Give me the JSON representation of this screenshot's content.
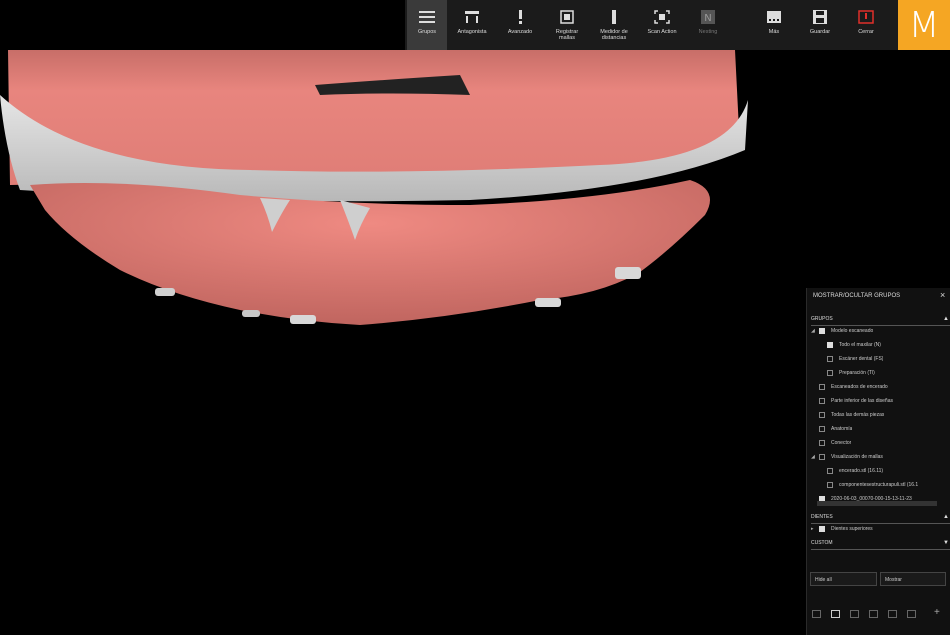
{
  "toolbar": {
    "items": [
      {
        "label": "Grupos",
        "icon": "menu-icon",
        "active": true
      },
      {
        "label": "Antagonista",
        "icon": "antagonist-icon"
      },
      {
        "label": "Avanzado",
        "icon": "exclamation-icon"
      },
      {
        "label": "Registrar\nmallas",
        "icon": "register-mesh-icon"
      },
      {
        "label": "Medidor de\ndistancias",
        "icon": "distance-meter-icon"
      },
      {
        "label": "Scan Action",
        "icon": "scan-icon"
      },
      {
        "label": "Nesting",
        "icon": "nesting-icon",
        "disabled": true
      },
      {
        "label": "Más",
        "icon": "more-icon"
      },
      {
        "label": "Guardar",
        "icon": "save-icon"
      },
      {
        "label": "Cerrar",
        "icon": "power-icon",
        "color": "#e0302a"
      }
    ],
    "logo": "M",
    "logo_color": "#f5a623"
  },
  "panel": {
    "title": "MOSTRAR/OCULTAR GRUPOS",
    "close": "×",
    "groups_header": "GRUPOS",
    "items": [
      {
        "label": "Modelo escaneado",
        "level": 0,
        "expand": "◢",
        "checked": true
      },
      {
        "label": "Todo el maxilar (N)",
        "level": 1,
        "checked": true
      },
      {
        "label": "Escáner dental (FS)",
        "level": 1
      },
      {
        "label": "Preparación (Tl)",
        "level": 1
      },
      {
        "label": "Escaneados de encerado",
        "level": 0
      },
      {
        "label": "Parte inferior de las diseñas",
        "level": 0
      },
      {
        "label": "Todas las demás piezas",
        "level": 0
      },
      {
        "label": "Anatomía",
        "level": 0
      },
      {
        "label": "Conector",
        "level": 0
      },
      {
        "label": "Visualización de mallas",
        "level": 0,
        "expand": "◢"
      },
      {
        "label": "encerado.stl (16.11)",
        "level": 1
      },
      {
        "label": "componentesestructurapuli.stl (16.1",
        "level": 1
      },
      {
        "label": "2020-06-03_00070-000-15-13-11-23",
        "level": 0,
        "checked": true
      }
    ],
    "teeth_header": "DIENTES",
    "teeth_items": [
      {
        "label": "Dientes superiores",
        "expand": "▸",
        "checked": true
      }
    ],
    "custom_header": "CUSTOM",
    "buttons": {
      "hide_all": "Hide all",
      "restore": "Mostrar"
    }
  }
}
